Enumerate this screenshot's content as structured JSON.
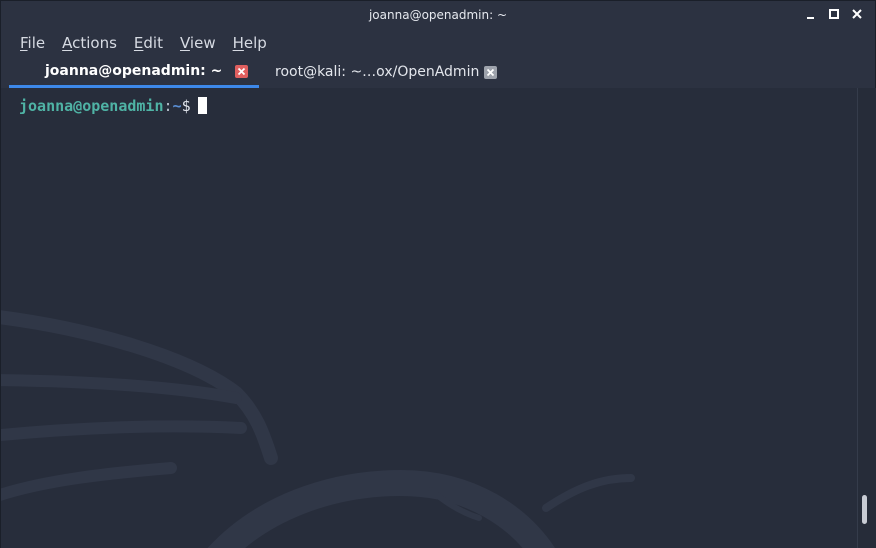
{
  "window": {
    "title": "joanna@openadmin: ~",
    "minimize_icon": "minimize-icon",
    "maximize_icon": "maximize-icon",
    "close_icon": "close-icon"
  },
  "menu": {
    "items": [
      {
        "mnemonic": "F",
        "rest": "ile"
      },
      {
        "mnemonic": "A",
        "rest": "ctions"
      },
      {
        "mnemonic": "E",
        "rest": "dit"
      },
      {
        "mnemonic": "V",
        "rest": "iew"
      },
      {
        "mnemonic": "H",
        "rest": "elp"
      }
    ]
  },
  "tabs": [
    {
      "label": "joanna@openadmin: ~",
      "active": true,
      "close_icon": "close-icon",
      "close_color": "#e05f5f"
    },
    {
      "label": "root@kali: ~…ox/OpenAdmin",
      "active": false,
      "close_icon": "close-icon",
      "close_color": "#9ea3ac"
    }
  ],
  "terminal": {
    "prompt_user": "joanna@openadmin",
    "prompt_sep": ":",
    "prompt_path": "~",
    "prompt_symbol": "$",
    "input": "",
    "background_watermark": "kali-dragon-logo"
  },
  "colors": {
    "accent": "#3d88e9",
    "prompt_user": "#4fb3a5",
    "prompt_path": "#5a8fd6",
    "terminal_bg": "#272d3b"
  }
}
